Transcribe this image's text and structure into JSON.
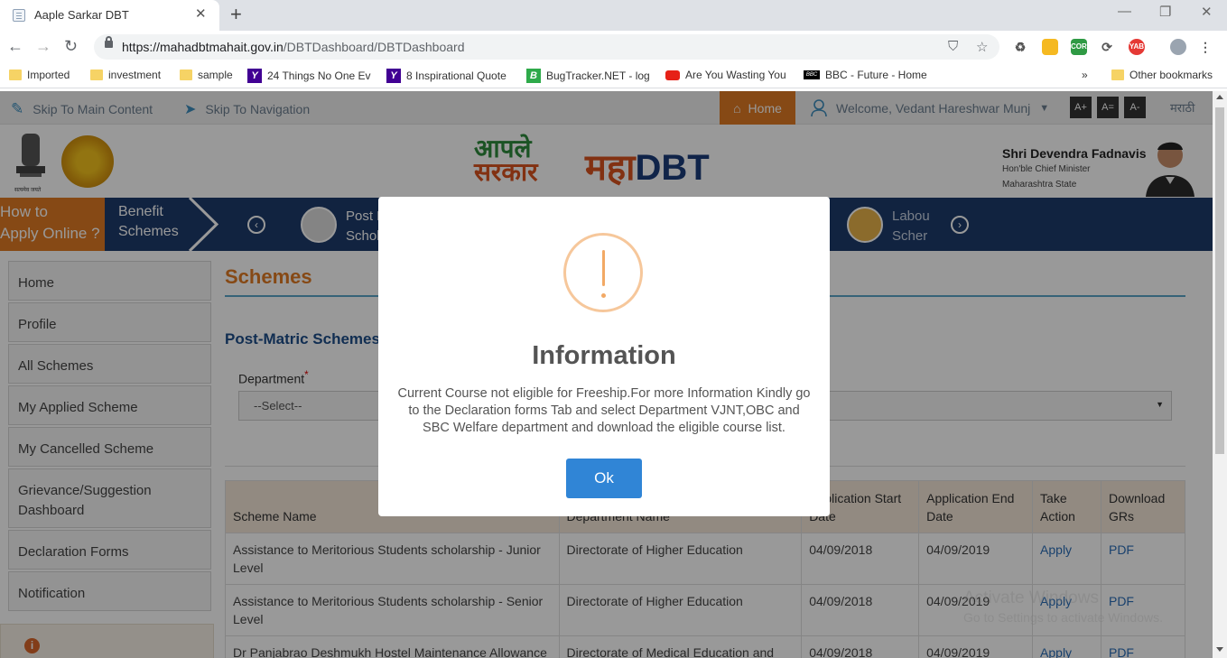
{
  "browser": {
    "tab_title": "Aaple Sarkar DBT",
    "url_host": "https://mahadbtmahait.gov.in",
    "url_path": "/DBTDashboard/DBTDashboard",
    "bookmarks": [
      "Imported",
      "investment",
      "sample",
      "24 Things No One Ev",
      "8 Inspirational Quote",
      "BugTracker.NET - log",
      "Are You Wasting You",
      "BBC - Future - Home"
    ],
    "bookmarks_more": "»",
    "other_bookmarks": "Other bookmarks",
    "extensions": [
      "CORS",
      "YAB"
    ]
  },
  "utilbar": {
    "skip_main": "Skip To Main Content",
    "skip_nav": "Skip To Navigation",
    "home": "Home",
    "welcome": "Welcome, Vedant Hareshwar Munj",
    "font_plus": "A+",
    "font_eq": "A=",
    "font_minus": "A-",
    "language": "मराठी"
  },
  "header": {
    "emblem_caption": "सत्यमेव जयते",
    "logo_line1": "आपले",
    "logo_line2": "सरकार",
    "logo_maha": "महा",
    "logo_dbt": "DBT",
    "cm_name": "Shri Devendra Fadnavis",
    "cm_title": "Hon'ble Chief Minister",
    "cm_state": "Maharashtra State"
  },
  "bluebar": {
    "how_to_line1": "How to",
    "how_to_line2": "Apply Online ?",
    "benefit_line1": "Benefit",
    "benefit_line2": "Schemes",
    "scheme1_line1": "Post M",
    "scheme1_line2": "Schol",
    "scheme2_line1": "Labou",
    "scheme2_line2": "Scher"
  },
  "sidebar": {
    "items": [
      "Home",
      "Profile",
      "All Schemes",
      "My Applied Scheme",
      "My Cancelled Scheme",
      "Grievance/Suggestion Dashboard",
      "Declaration Forms",
      "Notification"
    ]
  },
  "main": {
    "title": "Schemes",
    "subtitle": "Post-Matric Schemes",
    "department_label": "Department",
    "department_placeholder": "--Select--",
    "table": {
      "headers": [
        "Scheme Name",
        "Department Name",
        "Application Start Date",
        "Application End Date",
        "Take Action",
        "Download GRs"
      ],
      "rows": [
        [
          "Assistance to Meritorious Students scholarship - Junior Level",
          "Directorate of Higher Education",
          "04/09/2018",
          "04/09/2019",
          "Apply",
          "PDF"
        ],
        [
          "Assistance to Meritorious Students scholarship - Senior Level",
          "Directorate of Higher Education",
          "04/09/2018",
          "04/09/2019",
          "Apply",
          "PDF"
        ],
        [
          "Dr Panjabrao Deshmukh Hostel Maintenance Allowance",
          "Directorate of Medical Education and Research",
          "04/09/2018",
          "04/09/2019",
          "Apply",
          "PDF"
        ]
      ]
    }
  },
  "watermark": {
    "line1": "Activate Windows",
    "line2": "Go to Settings to activate Windows."
  },
  "modal": {
    "title": "Information",
    "message": "Current Course not eligible for Freeship.For more Information Kindly go to the Declaration forms Tab and select Department VJNT,OBC and SBC Welfare department and download the eligible course list.",
    "ok_label": "Ok",
    "icon_color": "#f8bb86",
    "button_color": "#3085d6"
  }
}
